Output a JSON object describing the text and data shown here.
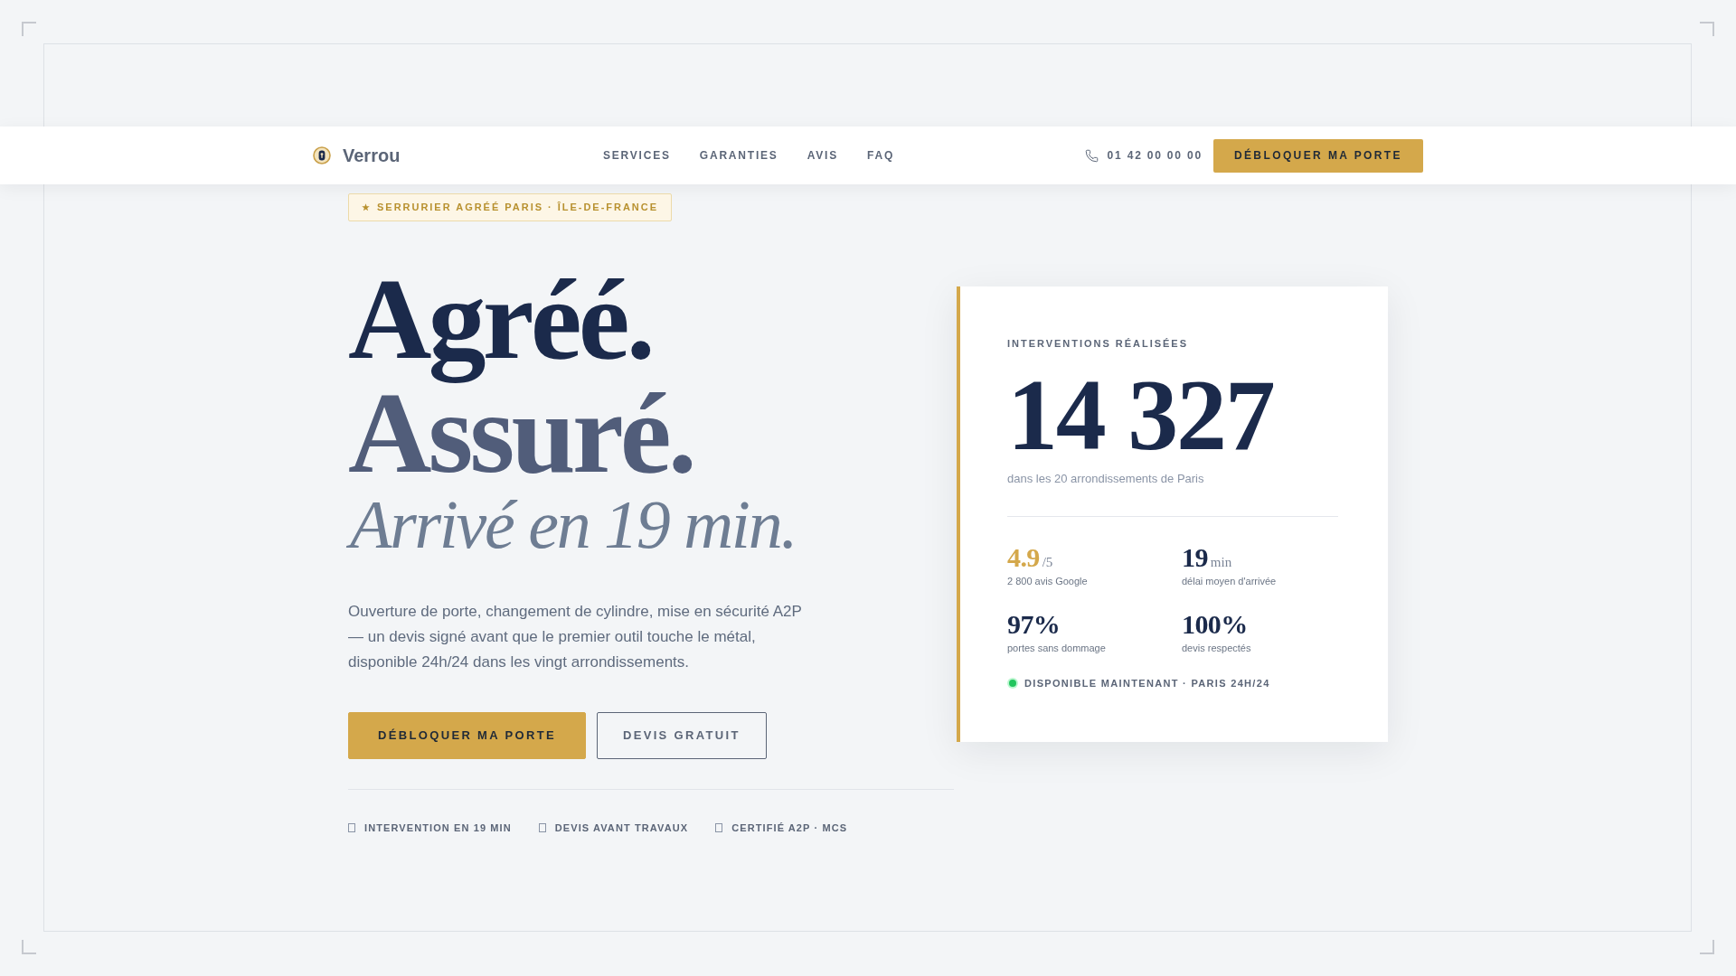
{
  "nav": {
    "brand": "Verrou",
    "links": [
      "SERVICES",
      "GARANTIES",
      "AVIS",
      "FAQ"
    ],
    "phone": "01 42 00 00 00",
    "cta": "DÉBLOQUER MA PORTE"
  },
  "hero": {
    "badge": "SERRURIER AGRÉÉ PARIS · ÎLE-DE-FRANCE",
    "headline": [
      {
        "text": "Agréé.",
        "kind": "strong"
      },
      {
        "text": "Assuré.",
        "kind": "muted"
      },
      {
        "text": "Arrivé en 19 min.",
        "kind": "italic"
      }
    ],
    "description": "Ouverture de porte, changement de cylindre, mise en sécurité A2P — un devis signé avant que le premier outil touche le métal, disponible 24h/24 dans les vingt arrondissements.",
    "buttons": [
      {
        "label": "DÉBLOQUER MA PORTE",
        "kind": "primary"
      },
      {
        "label": "DEVIS GRATUIT",
        "kind": "outline"
      }
    ],
    "features": [
      "INTERVENTION EN 19 MIN",
      "DEVIS AVANT TRAVAUX",
      "CERTIFIÉ A2P · MCS"
    ]
  },
  "stats_card": {
    "label": "INTERVENTIONS RÉALISÉES",
    "value": "14 327",
    "caption": "dans les 20 arrondissements de Paris",
    "stats": [
      {
        "value": "4.9",
        "unit": "/5",
        "caption": "2 800 avis Google",
        "kind": "accent"
      },
      {
        "value": "19",
        "unit": "min",
        "caption": "délai moyen d'arrivée",
        "kind": "plain"
      },
      {
        "value": "97%",
        "caption": "portes sans dommage",
        "kind": "plain"
      },
      {
        "value": "100%",
        "caption": "devis respectés",
        "kind": "plain"
      }
    ],
    "status": {
      "text": "DISPONIBLE MAINTENANT · PARIS 24H/24",
      "available": true
    }
  }
}
